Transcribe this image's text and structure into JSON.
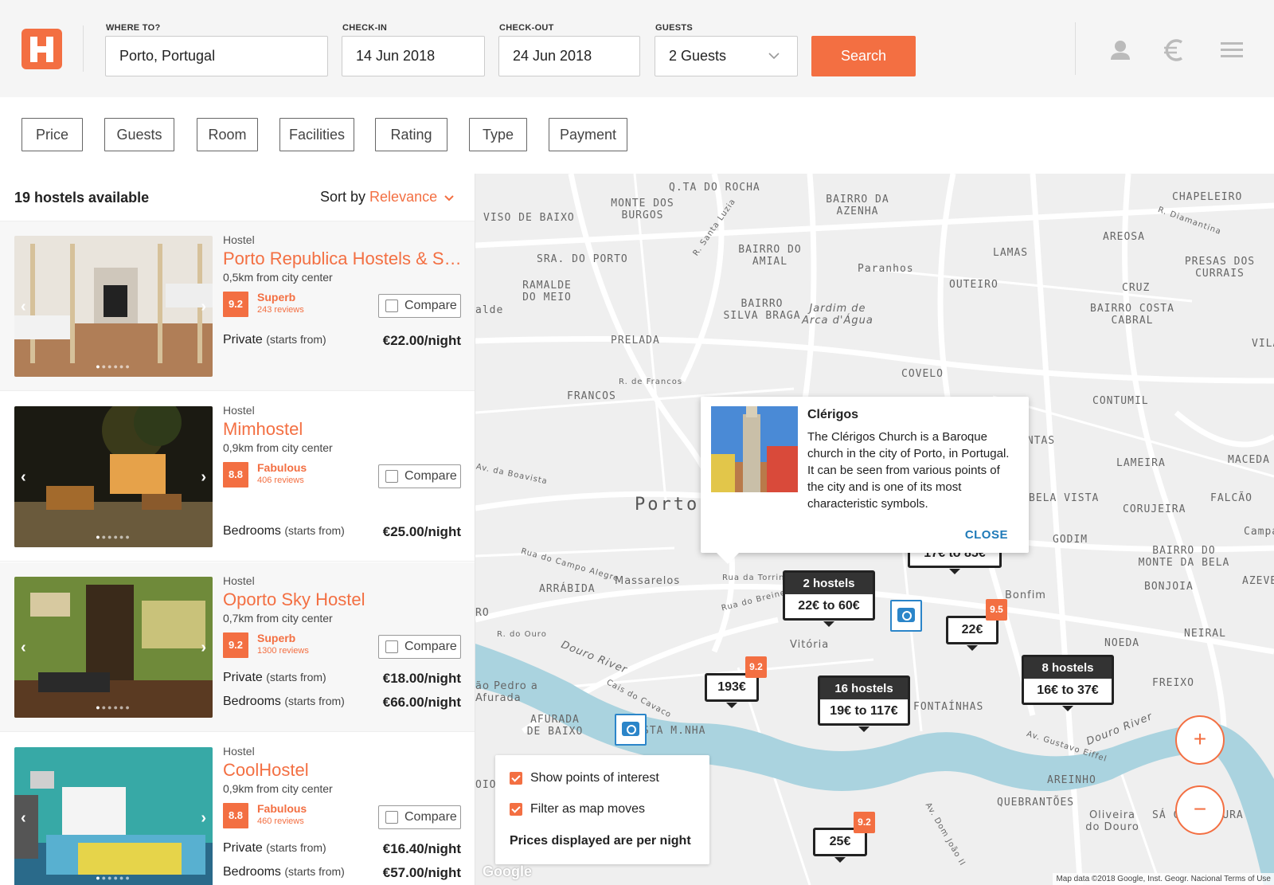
{
  "search": {
    "where_label": "WHERE TO?",
    "where_value": "Porto, Portugal",
    "checkin_label": "CHECK-IN",
    "checkin_value": "14 Jun 2018",
    "checkout_label": "CHECK-OUT",
    "checkout_value": "24 Jun 2018",
    "guests_label": "GUESTS",
    "guests_value": "2 Guests",
    "search_button": "Search"
  },
  "header_icons": [
    "user-icon",
    "currency-euro-icon",
    "menu-icon"
  ],
  "filters": [
    "Price",
    "Guests",
    "Room",
    "Facilities",
    "Rating",
    "Type",
    "Payment"
  ],
  "list": {
    "count": "19 hostels available",
    "sort_label": "Sort by",
    "sort_value": "Relevance",
    "compare_label": "Compare",
    "cards": [
      {
        "type": "Hostel",
        "name": "Porto Republica Hostels & Sui...",
        "distance": "0,5km from city center",
        "score": "9.2",
        "rating_word": "Superb",
        "reviews": "243 reviews",
        "prices": [
          {
            "label": "Private",
            "note": "(starts from)",
            "value": "€22.00/night"
          }
        ]
      },
      {
        "type": "Hostel",
        "name": "Mimhostel",
        "distance": "0,9km from city center",
        "score": "8.8",
        "rating_word": "Fabulous",
        "reviews": "406 reviews",
        "prices": [
          {
            "label": "Bedrooms",
            "note": "(starts from)",
            "value": "€25.00/night"
          }
        ]
      },
      {
        "type": "Hostel",
        "name": "Oporto Sky Hostel",
        "distance": "0,7km from city center",
        "score": "9.2",
        "rating_word": "Superb",
        "reviews": "1300 reviews",
        "prices": [
          {
            "label": "Private",
            "note": "(starts from)",
            "value": "€18.00/night"
          },
          {
            "label": "Bedrooms",
            "note": "(starts from)",
            "value": "€66.00/night"
          }
        ]
      },
      {
        "type": "Hostel",
        "name": "CoolHostel",
        "distance": "0,9km from city center",
        "score": "8.8",
        "rating_word": "Fabulous",
        "reviews": "460 reviews",
        "prices": [
          {
            "label": "Private",
            "note": "(starts from)",
            "value": "€16.40/night"
          },
          {
            "label": "Bedrooms",
            "note": "(starts from)",
            "value": "€57.00/night"
          }
        ]
      }
    ]
  },
  "map": {
    "place_labels": [
      "Q.TA DO ROCHA",
      "MONTE DOS BURGOS",
      "BAIRRO DA AZENHA",
      "CHAPELEIRO",
      "VISO DE BAIXO",
      "SRA. DO PORTO",
      "BAIRRO DO AMIAL",
      "LAMAS",
      "AREOSA",
      "PRESAS DOS CURRAIS",
      "RAMALDE DO MEIO",
      "Paranhos",
      "OUTEIRO",
      "CRUZ",
      "BAIRRO SILVA BRAGA",
      "Jardim de Arca d'Água",
      "BAIRRO COSTA CABRAL",
      "PRELADA",
      "COVELO",
      "FRANCOS",
      "CONTUMIL",
      "ANTAS",
      "LAMEIRA",
      "MACEDA",
      "Porto",
      "BELA VISTA",
      "CORUJEIRA",
      "FALCÃO",
      "GODIM",
      "Campa",
      "ARRÁBIDA",
      "Massarelos",
      "Bonfim",
      "BAIRRO DO MONTE DA BELA",
      "BONJOIA",
      "AZEVE",
      "Vitória",
      "NOEDA",
      "NEIRAL",
      "Douro River",
      "FONTAÍNHAS",
      "FREIXO",
      "AFURADA DE BAIXO",
      "ão Pedro a Afurada",
      "STA M.NHA",
      "AREINHO",
      "QUEBRANTÕES",
      "Oliveira do Douro",
      "SÁ CORREDOURA",
      "Douro River",
      "alde",
      "VILA",
      "RO",
      "OIO"
    ],
    "street_labels": [
      "R. Santa Luzia",
      "R. Diamantina",
      "R. de Francos",
      "Av. da Boavista",
      "Rua do Campo Alegre",
      "Rua da Torrinha",
      "Rua do Breiner",
      "R. do Ouro",
      "Cais do Cavaco",
      "Av. Gustavo Eiffel",
      "Av. Dom João II"
    ],
    "markers": [
      {
        "title": "2 hostels",
        "price": "22€ to 60€"
      },
      {
        "title": "",
        "price": "17€ to 85€"
      },
      {
        "title": "",
        "price": "22€",
        "badge": "9.5"
      },
      {
        "title": "",
        "price": "193€",
        "badge": "9.2"
      },
      {
        "title": "16 hostels",
        "price": "19€ to 117€"
      },
      {
        "title": "8 hostels",
        "price": "16€ to 37€"
      },
      {
        "title": "",
        "price": "25€",
        "badge": "9.2"
      }
    ],
    "popup": {
      "title": "Clérigos",
      "description": "The Clérigos Church is a Baroque church in the city of Porto, in Portugal. It can be seen from various points of the city and is one of its most characteristic symbols.",
      "close": "CLOSE"
    },
    "options": {
      "show_poi": "Show points of interest",
      "filter_map": "Filter as map moves",
      "note": "Prices displayed are per night"
    },
    "zoom_in": "+",
    "zoom_out": "−",
    "attribution": "Map data ©2018 Google, Inst. Geogr. Nacional   Terms of Use",
    "google": "Google"
  },
  "colors": {
    "accent": "#f36f42",
    "river": "#aad3df",
    "poi": "#2b85c9"
  }
}
